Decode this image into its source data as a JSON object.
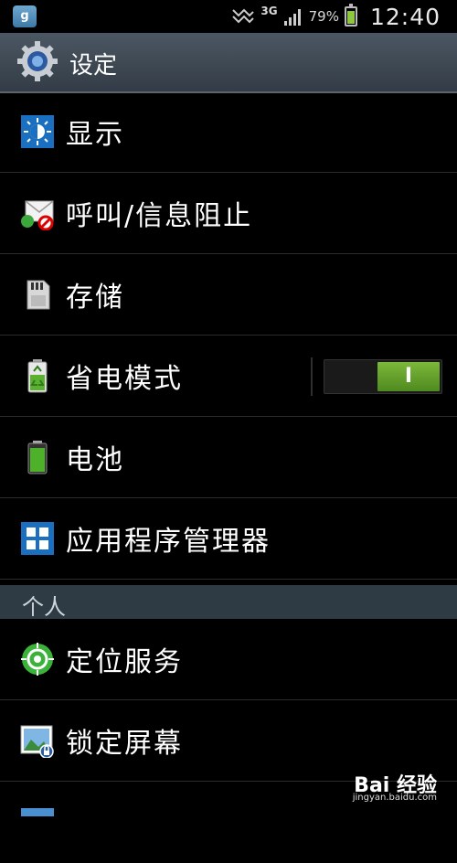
{
  "status_bar": {
    "app_glyph": "g",
    "network": "3G",
    "battery_percent": "79%",
    "battery_level": 0.79,
    "time": "12:40"
  },
  "header": {
    "title": "设定"
  },
  "rows": [
    {
      "label": "显示",
      "icon": "display-icon"
    },
    {
      "label": "呼叫/信息阻止",
      "icon": "call-block-icon"
    },
    {
      "label": "存储",
      "icon": "storage-icon"
    },
    {
      "label": "省电模式",
      "icon": "power-saving-icon",
      "toggle": {
        "state": "on",
        "text": "I"
      }
    },
    {
      "label": "电池",
      "icon": "battery-icon"
    },
    {
      "label": "应用程序管理器",
      "icon": "app-manager-icon"
    }
  ],
  "section_personal": {
    "label": "个人"
  },
  "rows_personal": [
    {
      "label": "定位服务",
      "icon": "location-icon"
    },
    {
      "label": "锁定屏幕",
      "icon": "lock-screen-icon"
    }
  ],
  "watermark": {
    "brand": "Bai 经验",
    "url": "jingyan.baidu.com"
  }
}
